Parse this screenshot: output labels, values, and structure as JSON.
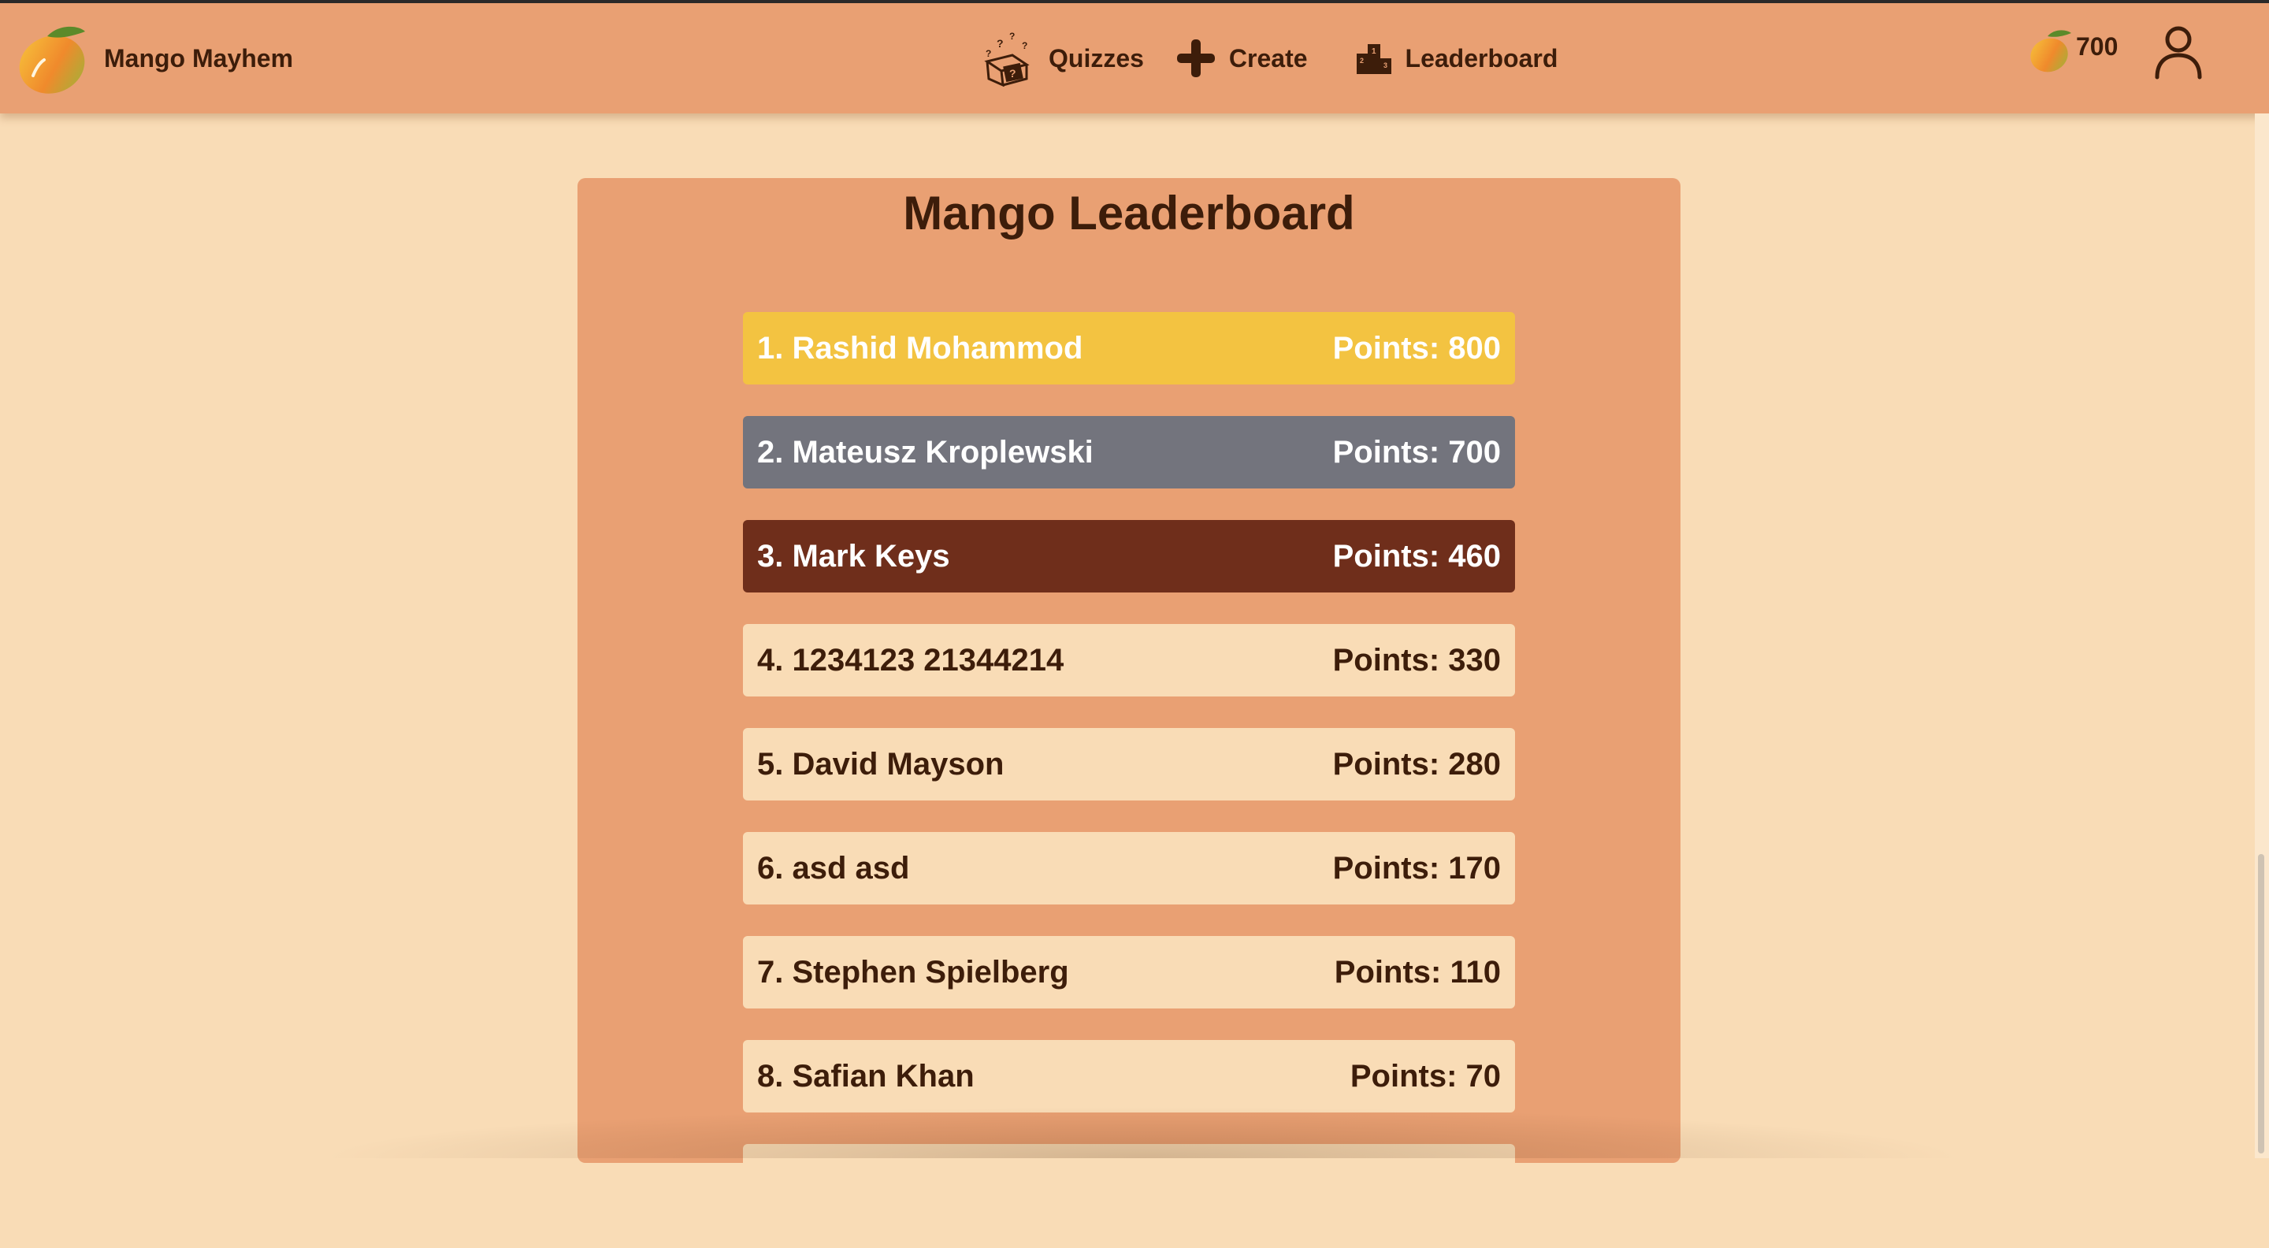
{
  "app": {
    "title": "Mango Mayhem"
  },
  "nav": {
    "items": [
      {
        "label": "Quizzes",
        "icon": "quiz-box-icon"
      },
      {
        "label": "Create",
        "icon": "plus-icon"
      },
      {
        "label": "Leaderboard",
        "icon": "podium-icon"
      }
    ]
  },
  "user": {
    "points": "700"
  },
  "leaderboard": {
    "title": "Mango Leaderboard",
    "rows": [
      {
        "name": "1. Rashid Mohammod",
        "points": "Points: 800"
      },
      {
        "name": "2. Mateusz Kroplewski",
        "points": "Points: 700"
      },
      {
        "name": "3. Mark Keys",
        "points": "Points: 460"
      },
      {
        "name": "4. 1234123 21344214",
        "points": "Points: 330"
      },
      {
        "name": "5. David Mayson",
        "points": "Points: 280"
      },
      {
        "name": "6. asd asd",
        "points": "Points: 170"
      },
      {
        "name": "7. Stephen Spielberg",
        "points": "Points: 110"
      },
      {
        "name": "8. Safian Khan",
        "points": "Points: 70"
      }
    ]
  },
  "colors": {
    "header": "#e9a073",
    "background": "#f9dcb6",
    "gold": "#f3c341",
    "silver": "#73747d",
    "bronze": "#6f2e1b",
    "text": "#3d1d0a"
  }
}
